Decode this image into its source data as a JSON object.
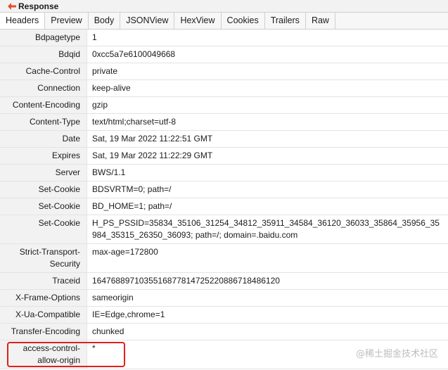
{
  "panel": {
    "title": "Response",
    "back_icon": "left-arrow-icon",
    "accent_color": "#e34f2a"
  },
  "tabs": [
    {
      "label": "Headers",
      "active": true
    },
    {
      "label": "Preview"
    },
    {
      "label": "Body"
    },
    {
      "label": "JSONView"
    },
    {
      "label": "HexView"
    },
    {
      "label": "Cookies"
    },
    {
      "label": "Trailers"
    },
    {
      "label": "Raw"
    }
  ],
  "headers": [
    {
      "name": "Bdpagetype",
      "value": "1"
    },
    {
      "name": "Bdqid",
      "value": "0xcc5a7e6100049668"
    },
    {
      "name": "Cache-Control",
      "value": "private"
    },
    {
      "name": "Connection",
      "value": "keep-alive"
    },
    {
      "name": "Content-Encoding",
      "value": "gzip"
    },
    {
      "name": "Content-Type",
      "value": "text/html;charset=utf-8"
    },
    {
      "name": "Date",
      "value": "Sat, 19 Mar 2022 11:22:51 GMT"
    },
    {
      "name": "Expires",
      "value": "Sat, 19 Mar 2022 11:22:29 GMT"
    },
    {
      "name": "Server",
      "value": "BWS/1.1"
    },
    {
      "name": "Set-Cookie",
      "value": "BDSVRTM=0; path=/"
    },
    {
      "name": "Set-Cookie",
      "value": "BD_HOME=1; path=/"
    },
    {
      "name": "Set-Cookie",
      "value": "H_PS_PSSID=35834_35106_31254_34812_35911_34584_36120_36033_35864_35956_35984_35315_26350_36093; path=/; domain=.baidu.com"
    },
    {
      "name": "Strict-Transport-Security",
      "value": "max-age=172800"
    },
    {
      "name": "Traceid",
      "value": "1647688971035516877814725220886718486120"
    },
    {
      "name": "X-Frame-Options",
      "value": "sameorigin"
    },
    {
      "name": "X-Ua-Compatible",
      "value": "IE=Edge,chrome=1"
    },
    {
      "name": "Transfer-Encoding",
      "value": "chunked"
    },
    {
      "name": "access-control-allow-origin",
      "value": "*"
    }
  ],
  "highlight_color": "#e0201b",
  "watermark": "@稀土掘金技术社区"
}
